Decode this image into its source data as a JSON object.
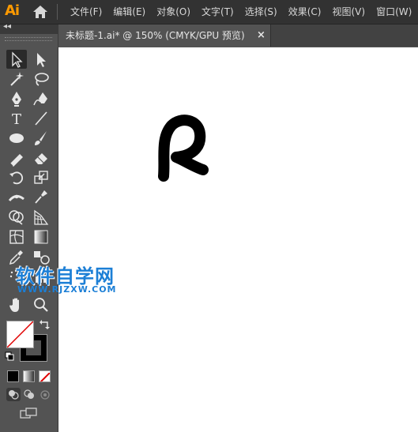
{
  "app": {
    "logo": "Ai"
  },
  "menu": {
    "items": [
      "文件(F)",
      "编辑(E)",
      "对象(O)",
      "文字(T)",
      "选择(S)",
      "效果(C)",
      "视图(V)",
      "窗口(W)"
    ]
  },
  "tabs": {
    "doc_title": "未标题-1.ai* @ 150% (CMYK/GPU 预览)",
    "close_glyph": "×"
  },
  "toolbar": {
    "collapse_glyph": "◂◂",
    "tools": [
      "selection-tool-icon",
      "direct-selection-tool-icon",
      "magic-wand-tool-icon",
      "lasso-tool-icon",
      "pen-tool-icon",
      "curvature-tool-icon",
      "type-tool-icon",
      "line-segment-tool-icon",
      "ellipse-tool-icon",
      "paintbrush-tool-icon",
      "shaper-tool-icon",
      "eraser-tool-icon",
      "rotate-tool-icon",
      "scale-tool-icon",
      "width-tool-icon",
      "puppet-warp-tool-icon",
      "shape-builder-tool-icon",
      "perspective-grid-tool-icon",
      "mesh-tool-icon",
      "gradient-tool-icon",
      "eyedropper-tool-icon",
      "blend-tool-icon",
      "symbol-sprayer-tool-icon",
      "column-graph-tool-icon",
      "hand-tool-icon",
      "zoom-tool-icon"
    ],
    "type_glyph": "T",
    "fill_color": "#ffffff",
    "stroke_color": "#000000"
  },
  "watermark": {
    "title": "软件自学网",
    "url": "WWW.RJZXW.COM"
  },
  "colors": {
    "menubar_bg": "#323232",
    "panel_bg": "#535353",
    "canvas_bg": "#ffffff",
    "logo_color": "#ff9a00",
    "watermark_color": "#1c7fd6"
  }
}
